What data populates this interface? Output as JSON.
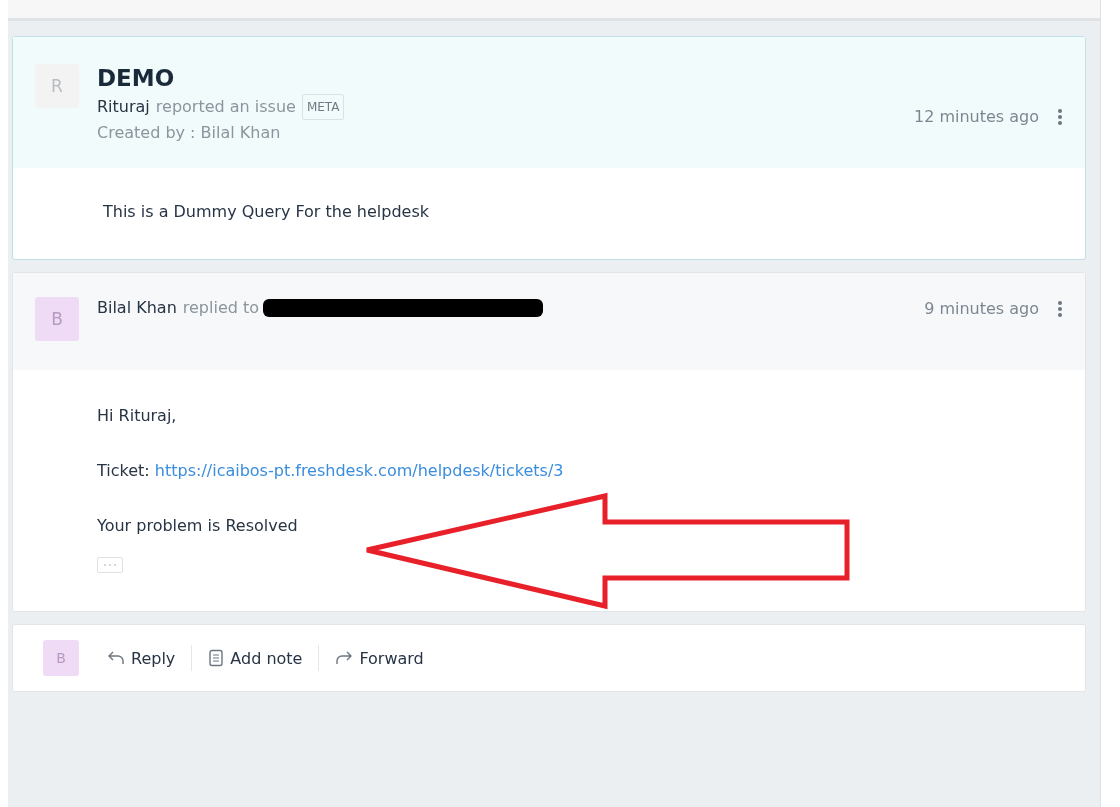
{
  "ticket": {
    "avatar": "R",
    "title": "DEMO",
    "reporter": "Rituraj",
    "action": "reported an issue",
    "tag": "META",
    "created_by": "Created by : Bilal Khan",
    "time": "12 minutes ago",
    "body": "This is a Dummy Query For the helpdesk"
  },
  "reply": {
    "avatar": "B",
    "author": "Bilal Khan",
    "action": "replied to",
    "time": "9 minutes ago",
    "greeting": "Hi Rituraj,",
    "ticket_label": "Ticket:",
    "ticket_link": "https://icaibos-pt.freshdesk.com/helpdesk/tickets/3",
    "message": "Your problem is Resolved"
  },
  "composer": {
    "avatar": "B",
    "actions": [
      {
        "kind": "reply",
        "label": "Reply"
      },
      {
        "kind": "note",
        "label": "Add note"
      },
      {
        "kind": "forward",
        "label": "Forward"
      }
    ]
  }
}
